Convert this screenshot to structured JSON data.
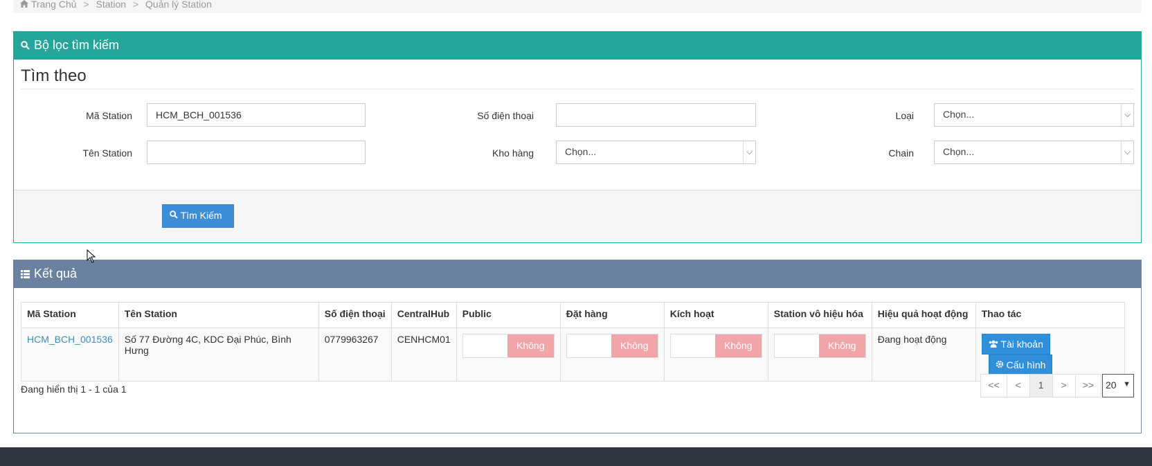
{
  "breadcrumb": {
    "items": [
      "Trang Chủ",
      "Station",
      "Quản lý Station"
    ],
    "separator": ">"
  },
  "filter_panel": {
    "title": "Bộ lọc tìm kiếm",
    "legend": "Tìm theo",
    "fields": {
      "ma_station_label": "Mã Station",
      "ma_station_value": "HCM_BCH_001536",
      "ten_station_label": "Tên Station",
      "ten_station_value": "",
      "so_dien_thoai_label": "Số điện thoại",
      "so_dien_thoai_value": "",
      "kho_hang_label": "Kho hàng",
      "kho_hang_value": "Chọn...",
      "loai_label": "Loại",
      "loai_value": "Chọn...",
      "chain_label": "Chain",
      "chain_value": "Chọn..."
    },
    "search_button": "Tìm Kiếm"
  },
  "result_panel": {
    "title": "Kết quả",
    "columns": [
      "Mã Station",
      "Tên Station",
      "Số điện thoại",
      "CentralHub",
      "Public",
      "Đặt hàng",
      "Kích hoạt",
      "Station vô hiệu hóa",
      "Hiệu quả hoạt động",
      "Thao tác"
    ],
    "rows": [
      {
        "ma_station": "HCM_BCH_001536",
        "ten_station": "Số 77 Đường 4C, KDC Đại Phúc, Bình Hưng",
        "so_dien_thoai": "0779963267",
        "central_hub": "CENHCM01",
        "public": "Không",
        "dat_hang": "Không",
        "kich_hoat": "Không",
        "vo_hieu_hoa": "Không",
        "hieu_qua": "Đang hoạt động",
        "btn_tai_khoan": "Tài khoản",
        "btn_cau_hinh": "Cấu hình"
      }
    ],
    "showing_text": "Đang hiển thị 1 - 1 của 1",
    "pagination": {
      "first": "<<",
      "prev": "<",
      "current": "1",
      "next": ">",
      "last": ">>",
      "page_size": "20"
    }
  },
  "colors": {
    "filter_header": "#26a69a",
    "result_header": "#6a81a0",
    "primary_button": "#3c8dd6",
    "toggle_off": "#f2a5a9",
    "link": "#3c8dbc"
  },
  "icons": [
    "home-icon",
    "search-icon",
    "list-icon",
    "users-icon",
    "gear-icon",
    "chevron-down-icon"
  ]
}
